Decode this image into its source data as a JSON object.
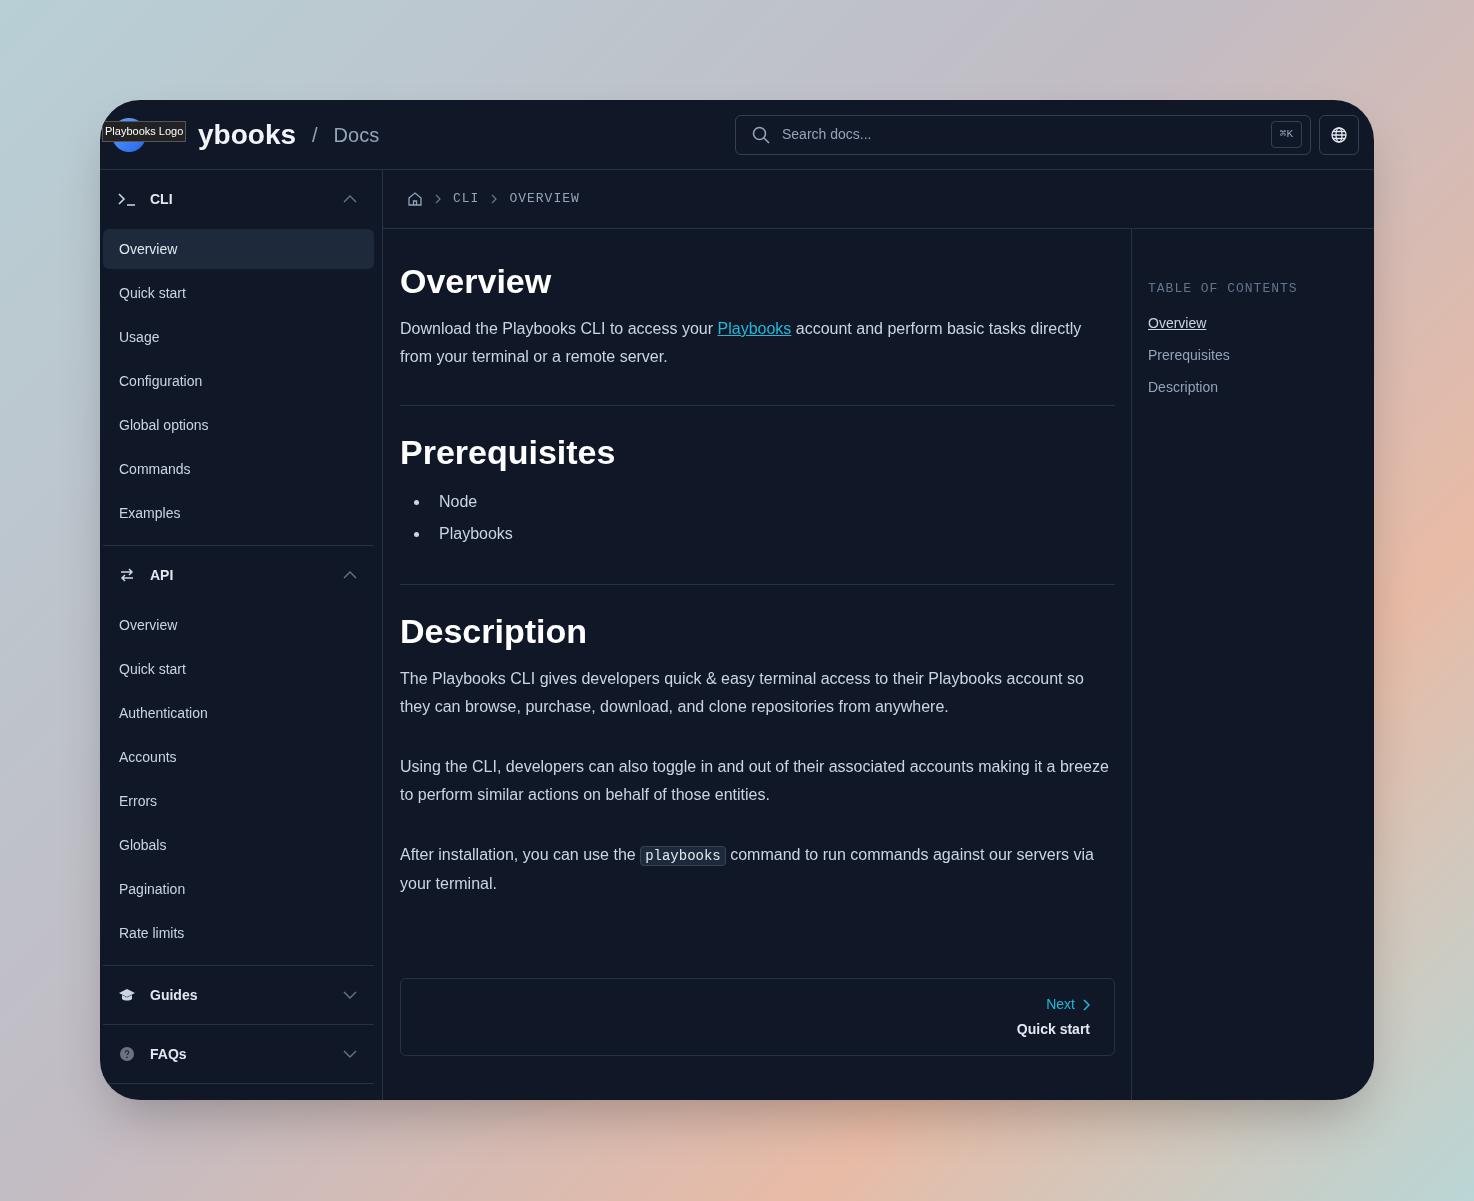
{
  "header": {
    "brand": "ybooks",
    "tooltip": "Playbooks Logo",
    "separator": "/",
    "section": "Docs",
    "search": {
      "placeholder": "Search docs...",
      "shortcut": "⌘K"
    }
  },
  "sidebar": {
    "groups": [
      {
        "title": "CLI",
        "kind": "terminal",
        "expanded": true,
        "items": [
          {
            "label": "Overview",
            "selected": true
          },
          {
            "label": "Quick start",
            "selected": false
          },
          {
            "label": "Usage",
            "selected": false
          },
          {
            "label": "Configuration",
            "selected": false
          },
          {
            "label": "Global options",
            "selected": false
          },
          {
            "label": "Commands",
            "selected": false
          },
          {
            "label": "Examples",
            "selected": false
          }
        ]
      },
      {
        "title": "API",
        "kind": "arrows",
        "expanded": true,
        "items": [
          {
            "label": "Overview",
            "selected": false
          },
          {
            "label": "Quick start",
            "selected": false
          },
          {
            "label": "Authentication",
            "selected": false
          },
          {
            "label": "Accounts",
            "selected": false
          },
          {
            "label": "Errors",
            "selected": false
          },
          {
            "label": "Globals",
            "selected": false
          },
          {
            "label": "Pagination",
            "selected": false
          },
          {
            "label": "Rate limits",
            "selected": false
          }
        ]
      },
      {
        "title": "Guides",
        "kind": "cap",
        "expanded": false
      },
      {
        "title": "FAQs",
        "kind": "question",
        "expanded": false
      }
    ]
  },
  "breadcrumb": [
    "CLI",
    "OVERVIEW"
  ],
  "article": {
    "sections": [
      {
        "heading": "Overview",
        "blocks": [
          {
            "kind": "paragraph",
            "parts": [
              {
                "kind": "text",
                "text": "Download the Playbooks CLI to access your "
              },
              {
                "kind": "link",
                "text": "Playbooks"
              },
              {
                "kind": "text",
                "text": " account and perform basic tasks directly from your terminal or a remote server."
              }
            ]
          }
        ]
      },
      {
        "heading": "Prerequisites",
        "blocks": [
          {
            "kind": "list",
            "items": [
              "Node",
              "Playbooks"
            ]
          }
        ]
      },
      {
        "heading": "Description",
        "blocks": [
          {
            "kind": "paragraph",
            "parts": [
              {
                "kind": "text",
                "text": "The Playbooks CLI gives developers quick & easy terminal access to their Playbooks account so they can browse, purchase, download, and clone repositories from anywhere."
              }
            ]
          },
          {
            "kind": "paragraph",
            "parts": [
              {
                "kind": "text",
                "text": "Using the CLI, developers can also toggle in and out of their associated accounts making it a breeze to perform similar actions on behalf of those entities."
              }
            ]
          },
          {
            "kind": "paragraph",
            "parts": [
              {
                "kind": "text",
                "text": "After installation, you can use the "
              },
              {
                "kind": "code",
                "text": "playbooks"
              },
              {
                "kind": "text",
                "text": " command to run commands against our servers via your terminal."
              }
            ]
          }
        ]
      }
    ],
    "next": {
      "label": "Next",
      "title": "Quick start"
    }
  },
  "toc": {
    "title": "TABLE OF CONTENTS",
    "items": [
      {
        "label": "Overview",
        "selected": true
      },
      {
        "label": "Prerequisites",
        "selected": false
      },
      {
        "label": "Description",
        "selected": false
      }
    ]
  }
}
